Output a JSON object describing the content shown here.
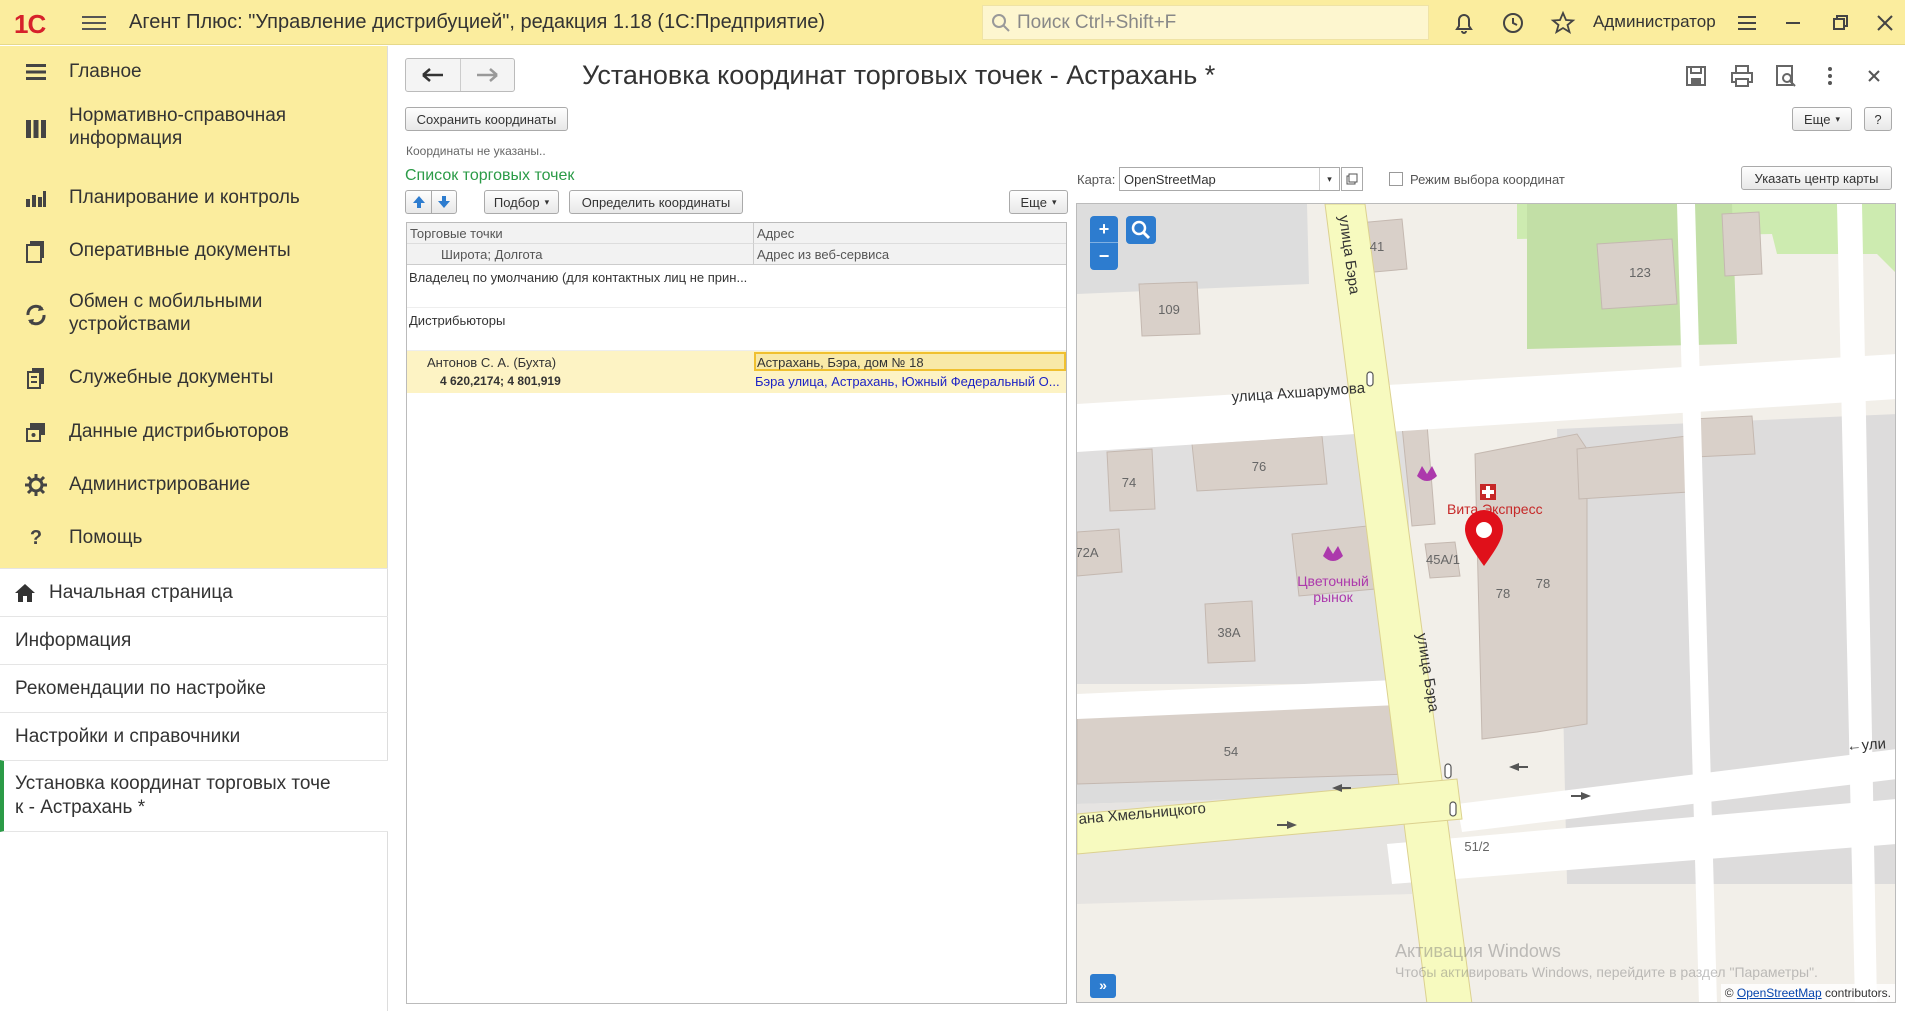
{
  "app": {
    "logo": "1С",
    "title": "Агент Плюс: \"Управление дистрибуцией\", редакция 1.18  (1С:Предприятие)",
    "search_placeholder": "Поиск Ctrl+Shift+F",
    "user": "Администратор"
  },
  "sections": [
    {
      "label": "Главное",
      "icon": "menu-lines-icon"
    },
    {
      "label": "Нормативно-справочная\nинформация",
      "icon": "reference-books-icon"
    },
    {
      "label": "Планирование и контроль",
      "icon": "bar-chart-icon"
    },
    {
      "label": "Оперативные документы",
      "icon": "documents-icon"
    },
    {
      "label": "Обмен с мобильными\nустройствами",
      "icon": "sync-icon"
    },
    {
      "label": "Служебные документы",
      "icon": "service-docs-icon"
    },
    {
      "label": "Данные дистрибьюторов",
      "icon": "distributor-data-icon"
    },
    {
      "label": "Администрирование",
      "icon": "gear-icon"
    },
    {
      "label": "Помощь",
      "icon": "question-icon"
    }
  ],
  "open_windows": [
    {
      "label": "Начальная страница",
      "icon": "home-icon"
    },
    {
      "label": "Информация"
    },
    {
      "label": "Рекомендации по настройке"
    },
    {
      "label": "Настройки и справочники"
    },
    {
      "label": "Установка координат торговых точе\nк - Астрахань *",
      "active": true
    }
  ],
  "form": {
    "title": "Установка координат торговых точек - Астрахань *",
    "save_coords": "Сохранить координаты",
    "more": "Еще",
    "help": "?",
    "hint": "Координаты не указаны..",
    "list_title": "Список торговых точек",
    "pick": "Подбор",
    "define_coords": "Определить координаты",
    "list_more": "Еще"
  },
  "table": {
    "headers": {
      "outlets": "Торговые точки",
      "address": "Адрес",
      "latlon": "Широта; Долгота",
      "ws_address": "Адрес из веб-сервиса"
    },
    "rows": {
      "owner": "Владелец по умолчанию (для контактных лиц не прин...",
      "distributors": "Дистрибьюторы",
      "outlet_name": "Антонов С. А. (Бухта)",
      "outlet_address": "Астрахань, Бэра, дом № 18",
      "outlet_coords": "4 620,2174; 4 801,919",
      "outlet_ws_address": "Бэра улица, Астрахань, Южный Федеральный О..."
    }
  },
  "map_panel": {
    "map_label": "Карта:",
    "map_value": "OpenStreetMap",
    "mode_label": "Режим выбора координат",
    "center_button": "Указать центр карты",
    "zoom_in": "+",
    "zoom_out": "−",
    "expand": "»",
    "attribution_prefix": "©",
    "attribution_link": "OpenStreetMap",
    "attribution_suffix": "contributors.",
    "watermark_title": "Активация Windows",
    "watermark_text": "Чтобы активировать Windows, перейдите в раздел \"Параметры\"."
  },
  "map_labels": {
    "street_ber_top": "улица Бэра",
    "street_akhsh": "улица Ахшарумова",
    "street_ber_bottom": "улица Бэра",
    "street_khmel": "ана Хмельницкого",
    "street_right": "←ули",
    "pharmacy": "Вита Экспресс",
    "flower_market_1": "Цветочный",
    "flower_market_2": "рынок",
    "b41": "41",
    "b123": "123",
    "b109": "109",
    "b74": "74",
    "b76": "76",
    "b72a": "72А",
    "b45a1": "45А/1",
    "b78a": "78",
    "b78b": "78",
    "b38a": "38А",
    "b54": "54",
    "b512": "51/2"
  },
  "colors": {
    "header_bg": "#fbed9e",
    "accent_green": "#2b9b47",
    "road_yellow": "#f7fabf",
    "marker_red": "#e0101a",
    "selected_row": "#fdf3c4"
  }
}
